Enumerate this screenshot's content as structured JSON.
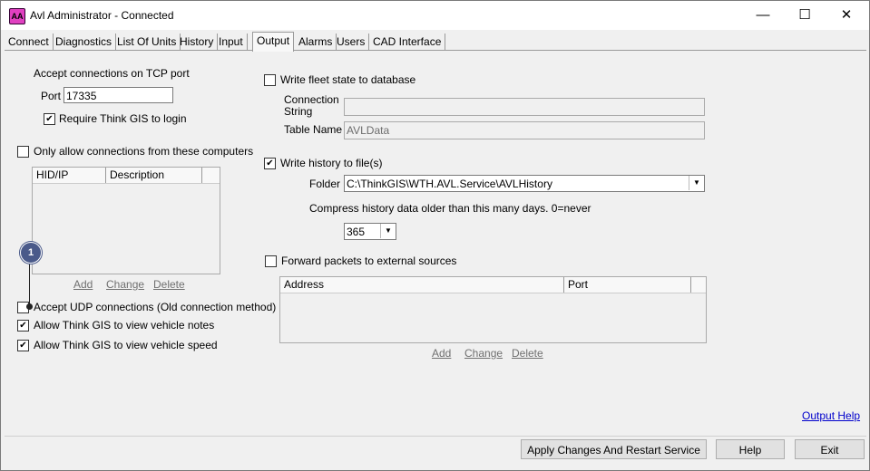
{
  "window": {
    "title": "Avl Administrator - Connected",
    "icon": "avl-app-icon",
    "icon_text": "AA",
    "controls": {
      "minimize": "—",
      "maximize": "☐",
      "close": "✕"
    }
  },
  "tabs": [
    "Connect",
    "Diagnostics",
    "List Of Units",
    "History",
    "Input",
    "Output",
    "Alarms",
    "Users",
    "CAD Interface"
  ],
  "active_tab": "Output",
  "left": {
    "tcp_heading": "Accept connections on TCP port",
    "port_label": "Port",
    "port_value": "17335",
    "require_login_label": "Require Think GIS to login",
    "require_login_checked": true,
    "only_allow_label": "Only allow connections from these computers",
    "only_allow_checked": false,
    "hosts_columns": [
      "HID/IP",
      "Description"
    ],
    "hosts_rows": [],
    "add_link": "Add",
    "change_link": "Change",
    "delete_link": "Delete",
    "udp_label": "Accept UDP connections (Old connection method)",
    "udp_checked": false,
    "notes_label": "Allow Think GIS to view vehicle notes",
    "notes_checked": true,
    "speed_label": "Allow Think GIS to view vehicle speed",
    "speed_checked": true
  },
  "right": {
    "write_db_label": "Write fleet state to database",
    "write_db_checked": false,
    "connection_string_label_1": "Connection",
    "connection_string_label_2": "String",
    "connection_string_value": "",
    "table_name_label": "Table Name",
    "table_name_value": "AVLData",
    "write_history_label": "Write history to file(s)",
    "write_history_checked": true,
    "folder_label": "Folder",
    "folder_value": "C:\\ThinkGIS\\WTH.AVL.Service\\AVLHistory",
    "compress_label": "Compress history data older than this many days.  0=never",
    "compress_value": "365",
    "forward_label": "Forward packets to external sources",
    "forward_checked": false,
    "forward_columns": [
      "Address",
      "Port"
    ],
    "forward_rows": [],
    "add_link": "Add",
    "change_link": "Change",
    "delete_link": "Delete"
  },
  "footer": {
    "output_help_link": "Output Help",
    "apply_button": "Apply Changes And Restart Service",
    "help_button": "Help",
    "exit_button": "Exit"
  },
  "annotation": {
    "callout_number": "1"
  },
  "check_glyph": "✔"
}
